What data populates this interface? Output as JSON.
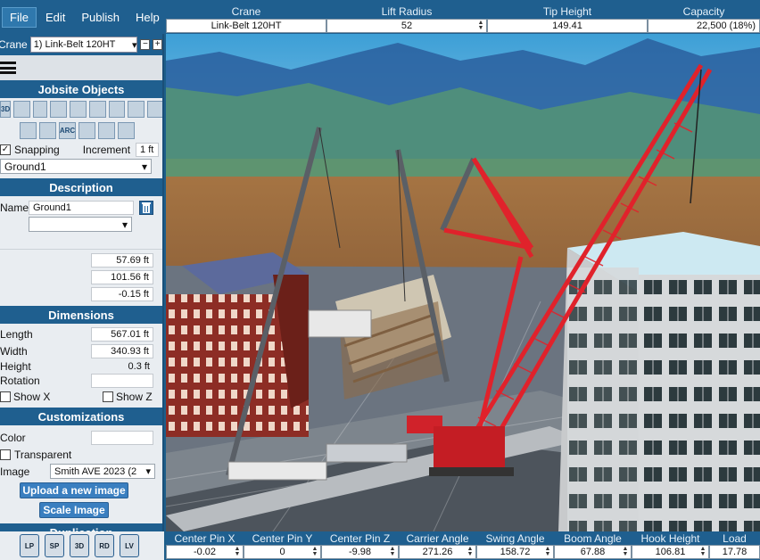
{
  "menu": [
    "File",
    "Edit",
    "Publish",
    "Help"
  ],
  "top_grid": {
    "headers": [
      "Crane",
      "Lift Radius",
      "Tip Height",
      "Capacity"
    ],
    "values": [
      "Link-Belt 120HT",
      "52",
      "149.41",
      "22,500 (18%)"
    ]
  },
  "left": {
    "crane_label": "Crane",
    "crane_selected": "1) Link-Belt 120HT",
    "jobsite_title": "Jobsite Objects",
    "snapping_label": "Snapping",
    "increment_label": "Increment",
    "increment_value": "1 ft",
    "object_selected": "Ground1",
    "description_title": "Description",
    "name_label": "Name",
    "name_value": "Ground1",
    "position_values": [
      "57.69 ft",
      "101.56 ft",
      "-0.15 ft"
    ],
    "dimensions_title": "Dimensions",
    "length_label": "Length",
    "length_value": "567.01 ft",
    "width_label": "Width",
    "width_value": "340.93 ft",
    "height_label": "Height",
    "height_value": "0.3 ft",
    "rotation_label": "Rotation",
    "show_x": "Show X",
    "show_z": "Show Z",
    "custom_title": "Customizations",
    "color_label": "Color",
    "transparent_label": "Transparent",
    "image_label": "Image",
    "image_selected": "Smith AVE 2023 (2",
    "upload_btn": "Upload a new image",
    "scale_btn": "Scale Image",
    "duplication_title": "Duplication",
    "tool_icons": [
      "3D",
      "cube",
      "box",
      "beam",
      "cylinder",
      "sphere",
      "slab",
      "pipe",
      "truss",
      "window",
      "road",
      "ARC",
      "grass",
      "image",
      "person"
    ]
  },
  "bottom_tools": [
    "LP",
    "SP",
    "3D",
    "RD",
    "LV"
  ],
  "bottom_grid": {
    "headers": [
      "Center Pin X",
      "Center Pin Y",
      "Center Pin Z",
      "Carrier Angle",
      "Swing Angle",
      "Boom Angle",
      "Hook Height",
      "Load"
    ],
    "values": [
      "-0.02",
      "0",
      "-9.98",
      "271.26",
      "158.72",
      "67.88",
      "106.81",
      "17.78"
    ]
  },
  "colors": {
    "panel_blue": "#1f5f8f",
    "crane_red": "#e0222b",
    "sky": "#3aa2d8"
  }
}
